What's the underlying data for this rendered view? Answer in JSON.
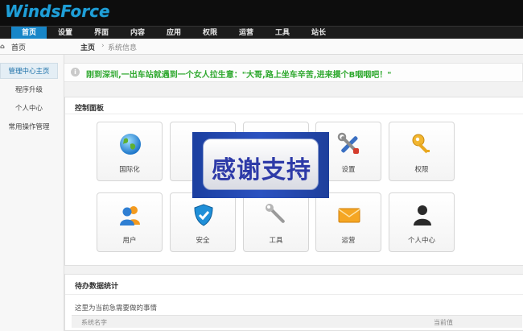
{
  "app": {
    "logo": "WindsForce"
  },
  "nav": {
    "items": [
      {
        "label": "首页",
        "active": true
      },
      {
        "label": "设置"
      },
      {
        "label": "界面"
      },
      {
        "label": "内容"
      },
      {
        "label": "应用"
      },
      {
        "label": "权限"
      },
      {
        "label": "运营"
      },
      {
        "label": "工具"
      },
      {
        "label": "站长"
      }
    ]
  },
  "breadcrumb": {
    "sidebar_home": "首页",
    "main": "主页",
    "separator": "›",
    "sub": "系统信息"
  },
  "sidebar": {
    "items": [
      {
        "label": "管理中心主页",
        "active": true
      },
      {
        "label": "程序升级"
      },
      {
        "label": "个人中心"
      },
      {
        "label": "常用操作管理"
      }
    ]
  },
  "notice": {
    "text": "刚到深圳,一出车站就遇到一个女人拉生意：\"大哥,路上坐车辛苦,进来摸个B咽咽吧！\""
  },
  "control_panel": {
    "title": "控制面板",
    "tiles": [
      {
        "label": "国际化",
        "icon": "globe-icon"
      },
      {
        "label": "",
        "icon": "hidden-icon"
      },
      {
        "label": "",
        "icon": "hidden-icon"
      },
      {
        "label": "设置",
        "icon": "tools-icon"
      },
      {
        "label": "权限",
        "icon": "key-icon"
      },
      {
        "label": "用户",
        "icon": "users-icon"
      },
      {
        "label": "安全",
        "icon": "shield-icon"
      },
      {
        "label": "工具",
        "icon": "wrench-icon"
      },
      {
        "label": "运营",
        "icon": "mail-icon"
      },
      {
        "label": "个人中心",
        "icon": "person-icon"
      }
    ]
  },
  "overlay": {
    "text": "感谢支持"
  },
  "pending": {
    "title": "待办数据统计",
    "description": "这里为当前急需要做的事情",
    "columns": [
      "系统名字",
      "当前值"
    ]
  }
}
